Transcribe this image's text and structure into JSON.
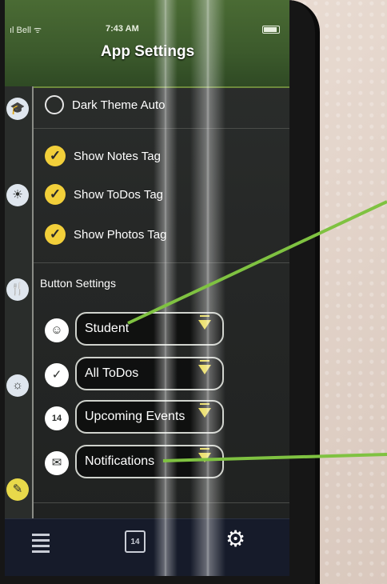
{
  "status_bar": {
    "carrier": "ıl Bell ᯤ",
    "time": "7:43 AM"
  },
  "header": {
    "title": "App Settings"
  },
  "theme_settings": {
    "dark_theme_label": "Dark Theme Auto"
  },
  "tag_settings": [
    {
      "label": "Show Notes Tag",
      "checked": true
    },
    {
      "label": "Show ToDos Tag",
      "checked": true
    },
    {
      "label": "Show Photos Tag",
      "checked": true
    }
  ],
  "button_settings": {
    "section_title": "Button Settings",
    "selects": [
      {
        "value": "Student",
        "icon": "student-icon"
      },
      {
        "value": "All ToDos",
        "icon": "checkmark-icon"
      },
      {
        "value": "Upcoming Events",
        "icon": "calendar-icon",
        "icon_text": "14"
      },
      {
        "value": "Notifications",
        "icon": "speech-bubble-icon"
      }
    ]
  },
  "tab_bar": {
    "calendar_day": "14",
    "items": [
      "menu-icon",
      "calendar-icon",
      "gear-icon"
    ]
  },
  "colors": {
    "header_green": "#3c5a2c",
    "check_yellow": "#f2cf3a",
    "arrow_yellow": "#e6d640",
    "annotation_green": "#7fc241",
    "tabbar_navy": "#161b2a"
  }
}
